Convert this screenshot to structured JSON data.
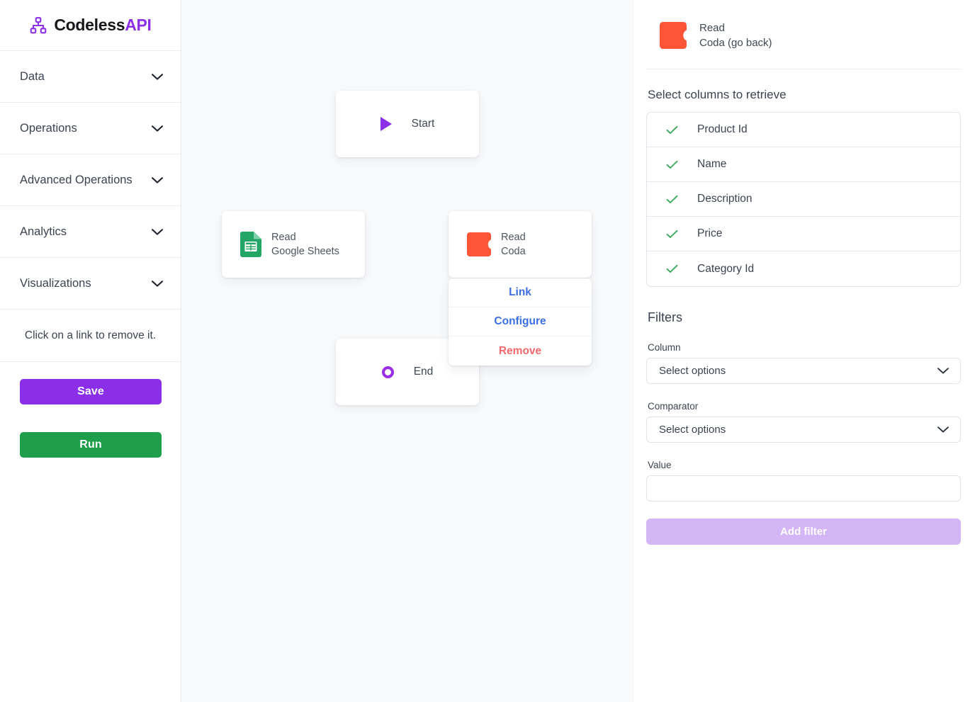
{
  "brand": {
    "name_main": "Codeless",
    "name_accent": "API",
    "logo_icon": "sitemap-icon",
    "accent_color": "#8b2ee8"
  },
  "sidebar": {
    "items": [
      {
        "label": "Data",
        "icon": "chevron-down-icon"
      },
      {
        "label": "Operations",
        "icon": "chevron-down-icon"
      },
      {
        "label": "Advanced Operations",
        "icon": "chevron-down-icon"
      },
      {
        "label": "Analytics",
        "icon": "chevron-down-icon"
      },
      {
        "label": "Visualizations",
        "icon": "chevron-down-icon"
      }
    ],
    "hint": "Click on a link to remove it.",
    "save_label": "Save",
    "run_label": "Run",
    "save_color": "#8b2ee8",
    "run_color": "#1e9e4a"
  },
  "canvas": {
    "background": "#f7f9fb",
    "nodes": [
      {
        "id": "start",
        "label": "Start",
        "icon": "play-icon",
        "icon_color": "#8b2ee8"
      },
      {
        "id": "read-google-sheets",
        "title": "Read",
        "subtitle": "Google Sheets",
        "icon": "google-sheets-icon",
        "icon_color": "#23a566"
      },
      {
        "id": "read-coda",
        "title": "Read",
        "subtitle": "Coda",
        "icon": "coda-icon",
        "icon_color": "#fb5436"
      },
      {
        "id": "end",
        "label": "End",
        "icon": "circle-outline-icon",
        "icon_color": "#9a2ee8"
      }
    ],
    "context_menu": [
      {
        "label": "Link",
        "color": "#3b6fe8"
      },
      {
        "label": "Configure",
        "color": "#3b6fe8"
      },
      {
        "label": "Remove",
        "color": "#f3686b"
      }
    ]
  },
  "panel": {
    "header": {
      "icon": "coda-icon",
      "icon_color": "#fb5436",
      "line1": "Read",
      "line2": "Coda (go back)"
    },
    "columns_title": "Select columns to retrieve",
    "columns": [
      {
        "label": "Product Id",
        "checked": true
      },
      {
        "label": "Name",
        "checked": true
      },
      {
        "label": "Description",
        "checked": true
      },
      {
        "label": "Price",
        "checked": true
      },
      {
        "label": "Category Id",
        "checked": true
      }
    ],
    "check_color": "#3aa95a",
    "filters": {
      "title": "Filters",
      "column_label": "Column",
      "column_value": "Select options",
      "comparator_label": "Comparator",
      "comparator_value": "Select options",
      "value_label": "Value",
      "value_value": "",
      "value_placeholder": "",
      "add_filter_label": "Add filter",
      "add_filter_color": "#d4b5f5"
    }
  }
}
